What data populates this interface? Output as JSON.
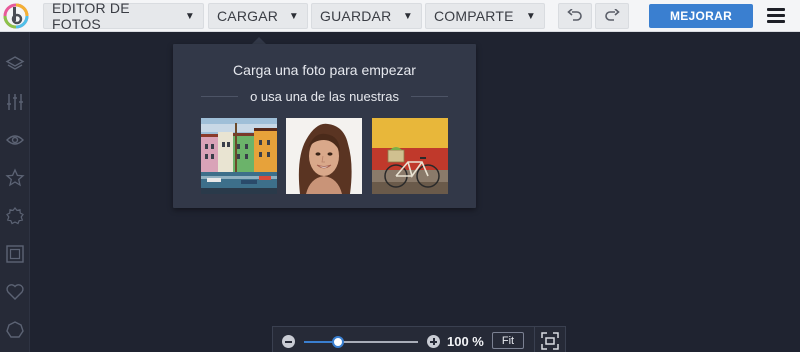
{
  "topbar": {
    "menus": [
      {
        "label": "EDITOR DE FOTOS"
      },
      {
        "label": "CARGAR"
      },
      {
        "label": "GUARDAR"
      },
      {
        "label": "COMPARTE"
      }
    ],
    "primary_label": "MEJORAR"
  },
  "sidebar": {
    "icons": [
      "layers-icon",
      "sliders-icon",
      "eye-icon",
      "star-icon",
      "badge-icon",
      "frame-icon",
      "heart-icon",
      "shape-icon"
    ]
  },
  "popup": {
    "title": "Carga una foto para empezar",
    "subtitle": "o usa una de las nuestras",
    "samples": [
      "sample-houses",
      "sample-portrait",
      "sample-bicycle"
    ]
  },
  "zoom": {
    "value": "100 %",
    "level_fraction": 0.3,
    "fit_label": "Fit"
  },
  "colors": {
    "accent": "#3a7fd0",
    "canvas_bg": "#1f2330",
    "popup_bg": "#323848"
  }
}
